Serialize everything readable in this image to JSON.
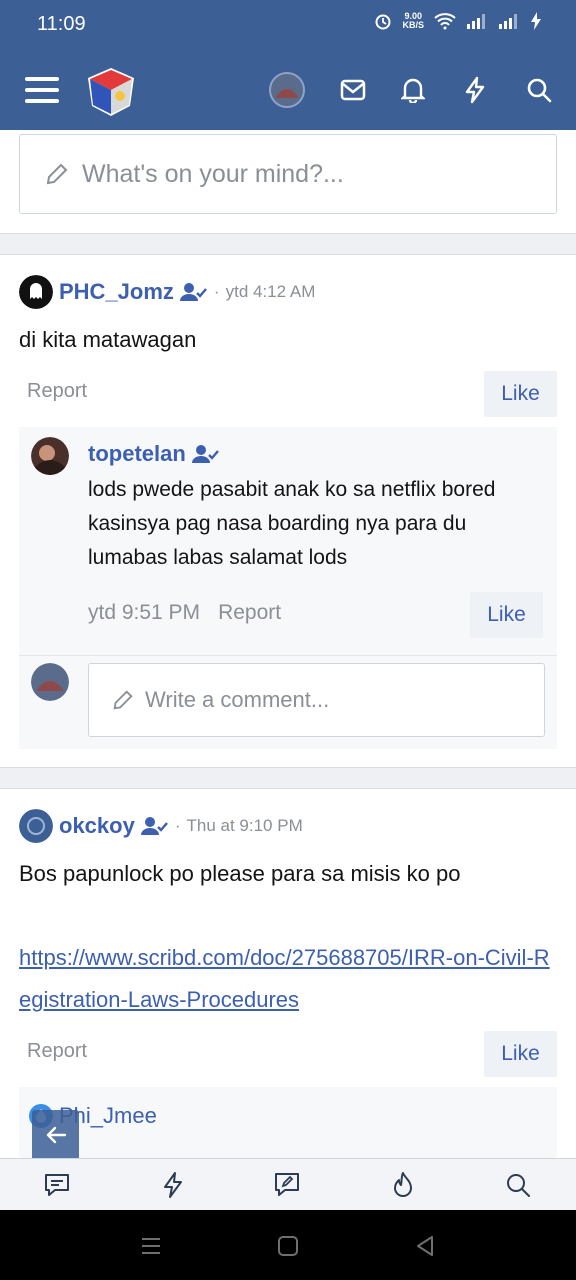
{
  "status": {
    "time": "11:09",
    "speed_value": "9.00",
    "speed_unit": "KB/S"
  },
  "appbar": {
    "icons": [
      "menu-icon",
      "site-logo",
      "user-avatar",
      "mail-icon",
      "bell-icon",
      "lightning-icon",
      "search-icon"
    ]
  },
  "composer": {
    "placeholder": "What's on your mind?..."
  },
  "posts": [
    {
      "user": "PHC_Jomz",
      "time": "ytd 4:12 AM",
      "text": "di kita matawagan",
      "report": "Report",
      "like": "Like",
      "comment": {
        "user": "topetelan",
        "text": "lods pwede pasabit anak ko sa netflix bored kasinsya pag nasa boarding nya para du lumabas labas salamat lods",
        "time": "ytd 9:51 PM",
        "report": "Report",
        "like": "Like"
      },
      "write_comment": "Write a comment..."
    },
    {
      "user": "okckoy",
      "time": "Thu at 9:10 PM",
      "text": "Bos papunlock po please para sa misis ko po",
      "link": "https://www.scribd.com/doc/275688705/IRR-on-Civil-Registration-Laws-Procedures",
      "report": "Report",
      "like": "Like",
      "comment_user": "Phi_Jmee"
    }
  ],
  "colors": {
    "brand": "#3c5f95",
    "link": "#3c5fb0",
    "muted": "#8a8f96"
  }
}
